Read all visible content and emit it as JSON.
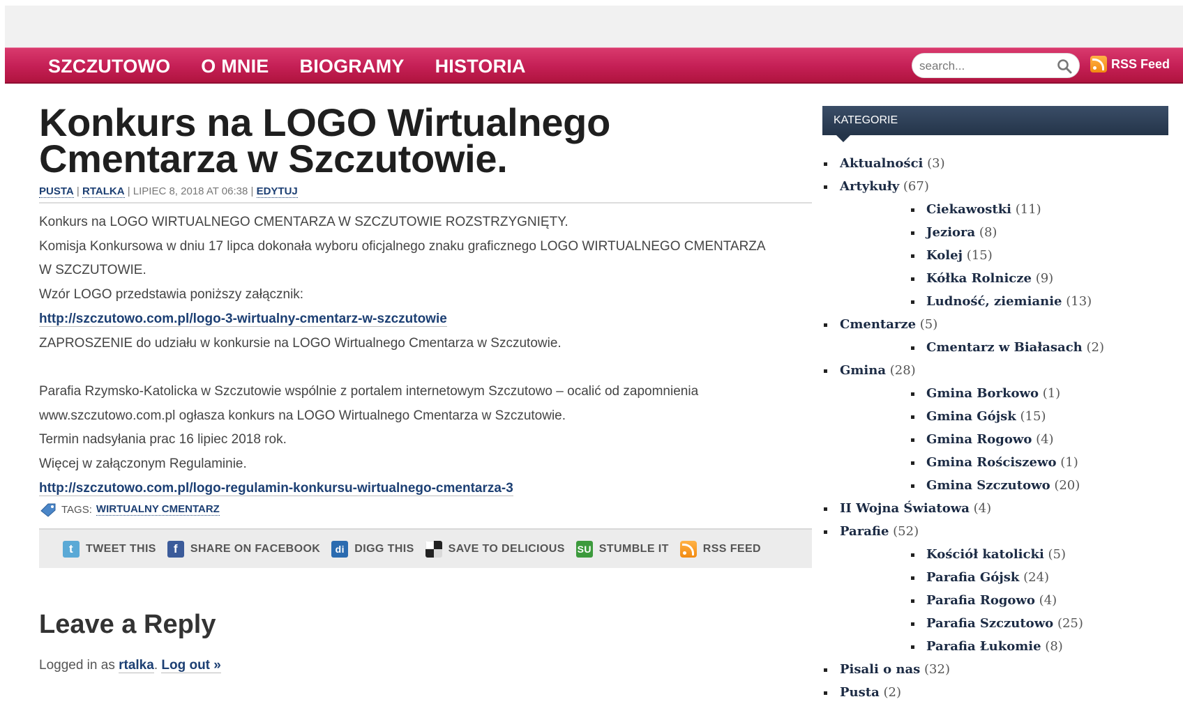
{
  "nav": {
    "items": [
      "SZCZUTOWO",
      "O MNIE",
      "BIOGRAMY",
      "HISTORIA"
    ],
    "search_placeholder": "search...",
    "rss_label": "RSS Feed"
  },
  "post": {
    "title": "Konkurs na LOGO Wirtualnego Cmentarza w Szczutowie.",
    "meta": {
      "category": "PUSTA",
      "author": "RTALKA",
      "date": "LIPIEC 8, 2018 AT 06:38",
      "edit": "EDYTUJ"
    },
    "lines": {
      "l1": "Konkurs na LOGO  WIRTUALNEGO  CMENTARZA  W  SZCZUTOWIE  ROZSTRZYGNIĘTY.",
      "l2": "Komisja Konkursowa w dniu 17 lipca dokonała wyboru oficjalnego znaku graficznego LOGO WIRTUALNEGO CMENTARZA",
      "l3": "W SZCZUTOWIE.",
      "l4": "Wzór LOGO przedstawia poniższy załącznik:",
      "link1": "http://szczutowo.com.pl/logo-3-wirtualny-cmentarz-w-szczutowie",
      "l5": "ZAPROSZENIE do udziału w konkursie na LOGO Wirtualnego Cmentarza w Szczutowie.",
      "l6": "Parafia Rzymsko-Katolicka w Szczutowie wspólnie z portalem internetowym Szczutowo – ocalić od zapomnienia",
      "l7": "www.szczutowo.com.pl ogłasza konkurs na LOGO Wirtualnego Cmentarza w Szczutowie.",
      "l8": "Termin nadsyłania prac 16 lipiec 2018 rok.",
      "l9": "Więcej w załączonym Regulaminie.",
      "link2": "http://szczutowo.com.pl/logo-regulamin-konkursu-wirtualnego-cmentarza-3"
    },
    "tags_label": "TAGS:",
    "tag": "WIRTUALNY CMENTARZ"
  },
  "share": {
    "tweet": "TWEET THIS",
    "facebook": "SHARE ON FACEBOOK",
    "digg": "DIGG THIS",
    "delicious": "SAVE TO DELICIOUS",
    "stumble": "STUMBLE IT",
    "rss": "RSS FEED"
  },
  "reply": {
    "title": "Leave a Reply",
    "logged_prefix": "Logged in as",
    "user": "rtalka",
    "logout": "Log out »"
  },
  "sidebar": {
    "heading": "KATEGORIE",
    "categories": [
      {
        "name": "Aktualności",
        "count": "(3)",
        "level": 1
      },
      {
        "name": "Artykuły",
        "count": "(67)",
        "level": 1
      },
      {
        "name": "Ciekawostki",
        "count": "(11)",
        "level": 2
      },
      {
        "name": "Jeziora",
        "count": "(8)",
        "level": 2
      },
      {
        "name": "Kolej",
        "count": "(15)",
        "level": 2
      },
      {
        "name": "Kółka Rolnicze",
        "count": "(9)",
        "level": 2
      },
      {
        "name": "Ludność, ziemianie",
        "count": "(13)",
        "level": 2
      },
      {
        "name": "Cmentarze",
        "count": "(5)",
        "level": 1
      },
      {
        "name": "Cmentarz w Białasach",
        "count": "(2)",
        "level": 2
      },
      {
        "name": "Gmina",
        "count": "(28)",
        "level": 1
      },
      {
        "name": "Gmina Borkowo",
        "count": "(1)",
        "level": 2
      },
      {
        "name": "Gmina Gójsk",
        "count": "(15)",
        "level": 2
      },
      {
        "name": "Gmina Rogowo",
        "count": "(4)",
        "level": 2
      },
      {
        "name": "Gmina Rościszewo",
        "count": "(1)",
        "level": 2
      },
      {
        "name": "Gmina Szczutowo",
        "count": "(20)",
        "level": 2
      },
      {
        "name": "II Wojna Światowa",
        "count": "(4)",
        "level": 1
      },
      {
        "name": "Parafie",
        "count": "(52)",
        "level": 1
      },
      {
        "name": "Kościół katolicki",
        "count": "(5)",
        "level": 2
      },
      {
        "name": "Parafia Gójsk",
        "count": "(24)",
        "level": 2
      },
      {
        "name": "Parafia Rogowo",
        "count": "(4)",
        "level": 2
      },
      {
        "name": "Parafia Szczutowo",
        "count": "(25)",
        "level": 2
      },
      {
        "name": "Parafia Łukomie",
        "count": "(8)",
        "level": 2
      },
      {
        "name": "Pisali o nas",
        "count": "(32)",
        "level": 1
      },
      {
        "name": "Pusta",
        "count": "(2)",
        "level": 1
      }
    ]
  },
  "colors": {
    "nav_bg": "#c41f55",
    "widget_head": "#243449",
    "link": "#1c3f73"
  }
}
